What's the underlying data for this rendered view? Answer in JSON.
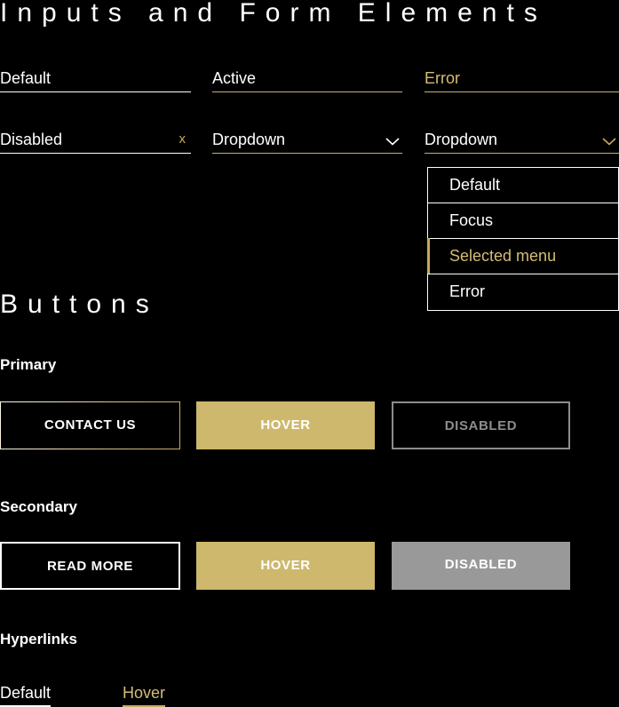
{
  "theme": {
    "background": "#000000",
    "accent_gold": "#cdb86d",
    "accent_gold_text": "#d3bd74",
    "white": "#ffffff",
    "disabled_gray": "#999999",
    "disabled_outline_gray": "#8d8d8d"
  },
  "sections": {
    "inputs_title": "Inputs and Form Elements",
    "buttons_title": "Buttons",
    "primary_label": "Primary",
    "secondary_label": "Secondary",
    "hyperlinks_label": "Hyperlinks"
  },
  "fields": {
    "default": {
      "value": "Default",
      "state": "default"
    },
    "active": {
      "value": "Active",
      "state": "active"
    },
    "error": {
      "value": "Error",
      "state": "error"
    },
    "disabled": {
      "value": "Disabled",
      "state": "disabled",
      "clear": "x"
    },
    "dropdown_1": {
      "value": "Dropdown",
      "state": "active",
      "chevron": "chevron-down-icon"
    },
    "dropdown_2": {
      "value": "Dropdown",
      "state": "error",
      "chevron": "chevron-down-icon"
    }
  },
  "dropdown_menu": {
    "open": true,
    "items": [
      {
        "label": "Default",
        "state": "default"
      },
      {
        "label": "Focus",
        "state": "focus"
      },
      {
        "label": "Selected menu",
        "state": "selected"
      },
      {
        "label": "Error",
        "state": "error"
      }
    ]
  },
  "buttons": {
    "primary": [
      {
        "label": "CONTACT US",
        "state": "default"
      },
      {
        "label": "HOVER",
        "state": "hover"
      },
      {
        "label": "DISABLED",
        "state": "disabled"
      }
    ],
    "secondary": [
      {
        "label": "READ MORE",
        "state": "default"
      },
      {
        "label": "HOVER",
        "state": "hover"
      },
      {
        "label": "DISABLED",
        "state": "disabled"
      }
    ]
  },
  "hyperlinks": [
    {
      "label": "Default",
      "state": "default"
    },
    {
      "label": "Hover",
      "state": "hover"
    }
  ]
}
